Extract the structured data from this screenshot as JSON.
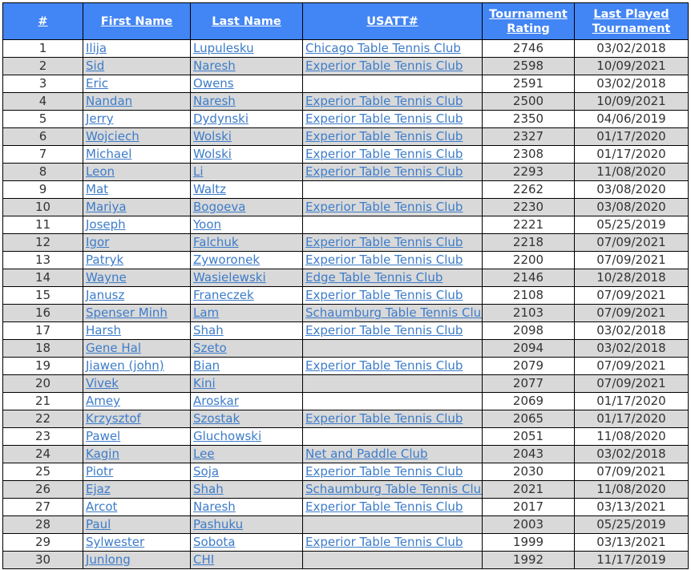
{
  "colors": {
    "header_bg": "#4285f4",
    "header_text": "#ffffff",
    "link": "#3d7cc9",
    "row_alt": "#d9d9d9"
  },
  "headers": [
    "#",
    "First Name",
    "Last Name",
    "USATT#",
    "Tournament Rating",
    "Last Played Tournament"
  ],
  "rows": [
    [
      "1",
      "Ilija",
      "Lupulesku",
      "Chicago Table Tennis Club",
      "2746",
      "03/02/2018"
    ],
    [
      "2",
      "Sid",
      "Naresh",
      "Experior Table Tennis Club",
      "2598",
      "10/09/2021"
    ],
    [
      "3",
      "Eric",
      "Owens",
      "",
      "2591",
      "03/02/2018"
    ],
    [
      "4",
      "Nandan",
      "Naresh",
      "Experior Table Tennis Club",
      "2500",
      "10/09/2021"
    ],
    [
      "5",
      "Jerry",
      "Dydynski",
      "Experior Table Tennis Club",
      "2350",
      "04/06/2019"
    ],
    [
      "6",
      "Wojciech",
      "Wolski",
      "Experior Table Tennis Club",
      "2327",
      "01/17/2020"
    ],
    [
      "7",
      "Michael",
      "Wolski",
      "Experior Table Tennis Club",
      "2308",
      "01/17/2020"
    ],
    [
      "8",
      "Leon",
      "Li",
      "Experior Table Tennis Club",
      "2293",
      "11/08/2020"
    ],
    [
      "9",
      "Mat",
      "Waltz",
      "",
      "2262",
      "03/08/2020"
    ],
    [
      "10",
      "Mariya",
      "Bogoeva",
      "Experior Table Tennis Club",
      "2230",
      "03/08/2020"
    ],
    [
      "11",
      "Joseph",
      "Yoon",
      "",
      "2221",
      "05/25/2019"
    ],
    [
      "12",
      "Igor",
      "Falchuk",
      "Experior Table Tennis Club",
      "2218",
      "07/09/2021"
    ],
    [
      "13",
      "Patryk",
      "Zyworonek",
      "Experior Table Tennis Club",
      "2200",
      "07/09/2021"
    ],
    [
      "14",
      "Wayne",
      "Wasielewski",
      "Edge Table Tennis Club",
      "2146",
      "10/28/2018"
    ],
    [
      "15",
      "Janusz",
      "Franeczek",
      "Experior Table Tennis Club",
      "2108",
      "07/09/2021"
    ],
    [
      "16",
      "Spenser Minh",
      "Lam",
      "Schaumburg Table Tennis Club",
      "2103",
      "07/09/2021"
    ],
    [
      "17",
      "Harsh",
      "Shah",
      "Experior Table Tennis Club",
      "2098",
      "03/02/2018"
    ],
    [
      "18",
      "Gene Hal",
      "Szeto",
      "",
      "2094",
      "03/02/2018"
    ],
    [
      "19",
      "Jiawen (john)",
      "Bian",
      "Experior Table Tennis Club",
      "2079",
      "07/09/2021"
    ],
    [
      "20",
      "Vivek",
      "Kini",
      "",
      "2077",
      "07/09/2021"
    ],
    [
      "21",
      "Amey",
      "Aroskar",
      "",
      "2069",
      "01/17/2020"
    ],
    [
      "22",
      "Krzysztof",
      "Szostak",
      "Experior Table Tennis Club",
      "2065",
      "01/17/2020"
    ],
    [
      "23",
      "Pawel",
      "Gluchowski",
      "",
      "2051",
      "11/08/2020"
    ],
    [
      "24",
      "Kagin",
      "Lee",
      "Net and Paddle Club",
      "2043",
      "03/02/2018"
    ],
    [
      "25",
      "Piotr",
      "Soja",
      "Experior Table Tennis Club",
      "2030",
      "07/09/2021"
    ],
    [
      "26",
      "Ejaz",
      "Shah",
      "Schaumburg Table Tennis Club",
      "2021",
      "11/08/2020"
    ],
    [
      "27",
      "Arcot",
      "Naresh",
      "Experior Table Tennis Club",
      "2017",
      "03/13/2021"
    ],
    [
      "28",
      "Paul",
      "Pashuku",
      "",
      "2003",
      "05/25/2019"
    ],
    [
      "29",
      "Sylwester",
      "Sobota",
      "Experior Table Tennis Club",
      "1999",
      "03/13/2021"
    ],
    [
      "30",
      "Junlong",
      "CHI",
      "",
      "1992",
      "11/17/2019"
    ]
  ]
}
